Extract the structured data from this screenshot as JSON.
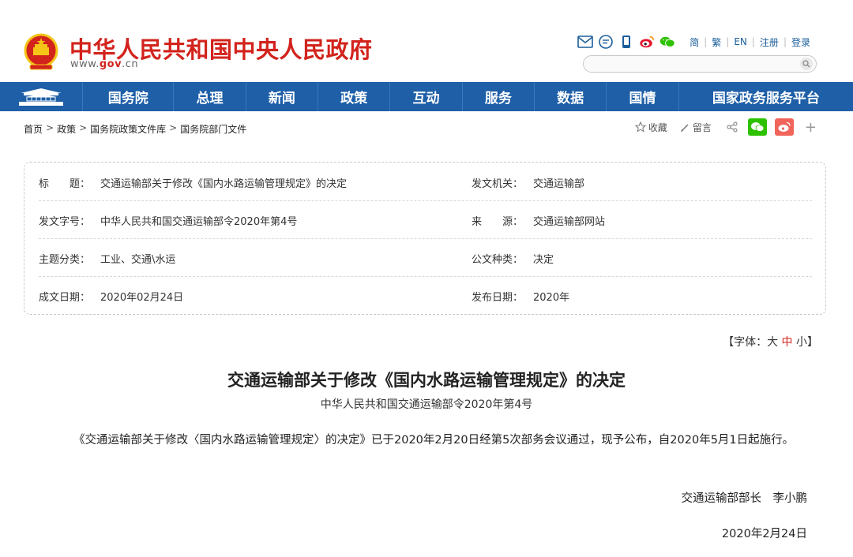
{
  "header": {
    "site_title": "中华人民共和国中央人民政府",
    "url_prefix": "www.",
    "url_domain": "gov",
    "url_suffix": ".cn",
    "links": [
      "简",
      "繁",
      "EN",
      "注册",
      "登录"
    ],
    "search_placeholder": ""
  },
  "nav": {
    "items": [
      "国务院",
      "总理",
      "新闻",
      "政策",
      "互动",
      "服务",
      "数据",
      "国情",
      "国家政务服务平台"
    ]
  },
  "breadcrumb": {
    "items": [
      "首页",
      "政策",
      "国务院政策文件库",
      "国务院部门文件"
    ],
    "separator": ">"
  },
  "share": {
    "favorite": "收藏",
    "comment": "留言",
    "more": "+"
  },
  "info": {
    "title_label": "标　　题：",
    "title_value": "交通运输部关于修改《国内水路运输管理规定》的决定",
    "issuer_label": "发文机关：",
    "issuer_value": "交通运输部",
    "doc_no_label": "发文字号：",
    "doc_no_value": "中华人民共和国交通运输部令2020年第4号",
    "source_label": "来　　源：",
    "source_value": "交通运输部网站",
    "topic_label": "主题分类：",
    "topic_value": "工业、交通\\水运",
    "type_label": "公文种类：",
    "type_value": "决定",
    "written_label": "成文日期：",
    "written_value": "2020年02月24日",
    "publish_label": "发布日期：",
    "publish_value": "2020年"
  },
  "font_control": {
    "prefix": "【字体：",
    "large": "大",
    "medium": "中",
    "small": "小",
    "suffix": "】"
  },
  "article": {
    "title": "交通运输部关于修改《国内水路运输管理规定》的决定",
    "subtitle": "中华人民共和国交通运输部令2020年第4号",
    "body": "《交通运输部关于修改〈国内水路运输管理规定〉的决定》已于2020年2月20日经第5次部务会议通过，现予公布，自2020年5月1日起施行。",
    "signature": "交通运输部部长　李小鹏",
    "date": "2020年2月24日"
  },
  "colors": {
    "brand_red": "#d2231c",
    "nav_blue": "#1e5fa8",
    "link_blue": "#1b5e9b",
    "wechat_green": "#2dc100",
    "weibo_red": "#f0645a"
  },
  "icons": [
    "national-emblem-icon",
    "mail-icon",
    "message-icon",
    "mobile-icon",
    "weibo-icon",
    "wechat-icon",
    "search-icon",
    "tiananmen-home-icon",
    "star-icon",
    "pen-icon",
    "share-icon",
    "plus-icon"
  ]
}
